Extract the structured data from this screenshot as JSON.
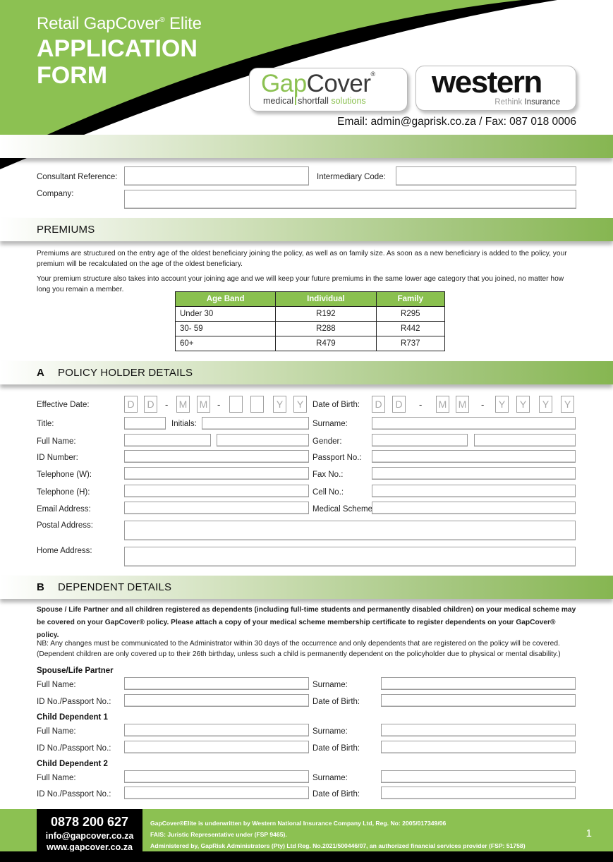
{
  "header": {
    "subtitle": "Retail GapCover",
    "subtitle_reg": "®",
    "subtitle_suffix": " Elite",
    "title_line1": "APPLICATION",
    "title_line2": "FORM",
    "contact": "Email: admin@gaprisk.co.za / Fax: 087 018 0006",
    "colors": {
      "brand_green": "#8cc152",
      "black": "#000000"
    }
  },
  "logos": {
    "gapcover": {
      "word_part1": "Gap",
      "word_part2": "Cover",
      "reg": "®",
      "tag_1": "medical",
      "tag_2": "shortfall",
      "tag_3": "solutions"
    },
    "western": {
      "word": "western",
      "tag_1": "Rethink",
      "tag_2": " Insurance"
    }
  },
  "consultant": {
    "consultant_reference_label": "Consultant Reference:",
    "intermediary_code_label": "Intermediary Code:",
    "company_label": "Company:",
    "consultant_reference_value": "",
    "intermediary_code_value": "",
    "company_value": ""
  },
  "premiums": {
    "heading": "PREMIUMS",
    "para1": "Premiums are structured on the entry age of the oldest beneficiary joining the policy, as well as on family size. As soon as a new beneficiary is added to the policy, your premium will be recalculated on the age of the oldest beneficiary.",
    "para2": "Your premium structure also takes into account your joining age and we will keep your future premiums in the same lower age category that you joined, no matter how long you remain a member.",
    "table": {
      "headers": [
        "Age Band",
        "Individual",
        "Family"
      ],
      "rows": [
        [
          "Under 30",
          "R192",
          "R295"
        ],
        [
          "30- 59",
          "R288",
          "R442"
        ],
        [
          "60+",
          "R479",
          "R737"
        ]
      ]
    }
  },
  "section_a": {
    "letter": "A",
    "heading": "POLICY HOLDER DETAILS",
    "effective_date_label": "Effective Date:",
    "effective_date_placeholders": [
      "D",
      "D",
      "M",
      "M",
      "",
      "",
      "Y",
      "Y"
    ],
    "date_of_birth_label": "Date of Birth:",
    "date_of_birth_placeholders": [
      "D",
      "D",
      "M",
      "M",
      "Y",
      "Y",
      "Y",
      "Y"
    ],
    "dash": "-",
    "title_label": "Title:",
    "initials_label": "Initials:",
    "surname_label": "Surname:",
    "full_name_label": "Full Name:",
    "gender_label": "Gender:",
    "id_number_label": "ID Number:",
    "passport_label": "Passport No.:",
    "tel_w_label": "Telephone (W):",
    "fax_label": "Fax No.:",
    "tel_h_label": "Telephone (H):",
    "cell_label": "Cell No.:",
    "email_label": "Email Address:",
    "medical_scheme_label": "Medical Scheme:",
    "postal_address_label": "Postal Address:",
    "home_address_label": "Home Address:"
  },
  "section_b": {
    "letter": "B",
    "heading": "DEPENDENT DETAILS",
    "bold_para": "Spouse / Life Partner and all children registered as dependents (including full-time students and permanently disabled children) on your medical scheme may be covered on your GapCover® policy. Please attach a copy of your medical scheme membership certificate to register dependents on your GapCover® policy.",
    "nb_para": "NB: Any changes must be communicated to the Administrator within 30 days of the occurrence and only dependents that are registered on the policy will be covered. (Dependent children are only covered up to their 26th birthday, unless such a child is permanently dependent on the policyholder due to physical or mental disability.)",
    "groups": [
      {
        "title": "Spouse/Life Partner"
      },
      {
        "title": "Child Dependent 1"
      },
      {
        "title": "Child Dependent 2"
      }
    ],
    "full_name_label": "Full Name:",
    "surname_label": "Surname:",
    "id_passport_label": "ID No./Passport No.:",
    "dob_label": "Date of Birth:"
  },
  "footer": {
    "phone": "0878 200 627",
    "email": "info@gapcover.co.za",
    "website": "www.gapcover.co.za",
    "legal_1": "GapCover®Elite is underwritten by Western National Insurance Company Ltd, Reg. No: 2005/017349/06",
    "legal_2": "FAIS: Juristic Representative under (FSP 9465).",
    "legal_3": "Administered by, GapRisk Administrators (Pty) Ltd Reg. No.2021/500446/07, an authorized financial services provider (FSP: 51758)",
    "page_number": "1"
  }
}
